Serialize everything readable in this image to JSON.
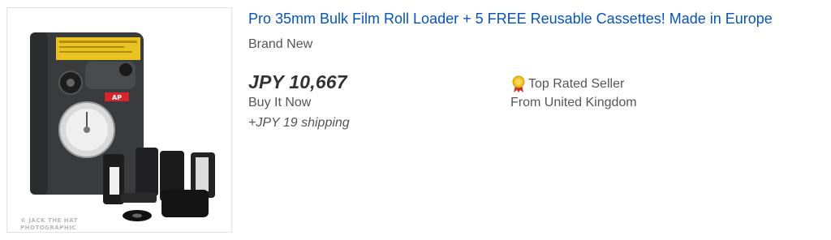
{
  "listing": {
    "title": "Pro 35mm Bulk Film Roll Loader + 5 FREE Reusable Cassettes! Made in Europe",
    "condition": "Brand New",
    "price": "JPY 10,667",
    "format": "Buy It Now",
    "shipping": "+JPY 19 shipping",
    "seller_badge": "Top Rated Seller",
    "origin": "From United Kingdom",
    "image_watermark": "© JACK THE HAT PHOTOGRAPHIC",
    "image_label": "AP"
  },
  "icons": {
    "badge": "top-rated-seller-ribbon-icon"
  },
  "colors": {
    "title_link": "#0654ba",
    "text_secondary": "#555555",
    "price_text": "#333333",
    "badge_gold": "#f2c11d"
  }
}
